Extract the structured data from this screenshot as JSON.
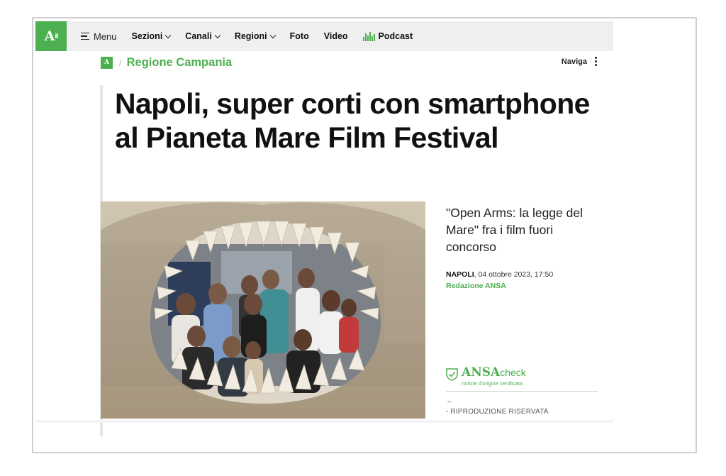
{
  "nav": {
    "logo_text": "A",
    "logo_suffix": "it",
    "menu_label": "Menu",
    "items": [
      {
        "label": "Sezioni",
        "dropdown": true
      },
      {
        "label": "Canali",
        "dropdown": true
      },
      {
        "label": "Regioni",
        "dropdown": true
      },
      {
        "label": "Foto",
        "dropdown": false
      },
      {
        "label": "Video",
        "dropdown": false
      }
    ],
    "podcast_label": "Podcast"
  },
  "breadcrumb": {
    "logo_text": "A",
    "separator": "/",
    "section": "Regione Campania",
    "naviga_label": "Naviga"
  },
  "article": {
    "headline": "Napoli, super corti con smartphone al Pianeta Mare Film Festival",
    "subtitle": "\"Open Arms: la legge del Mare\" fra i film fuori concorso",
    "location": "NAPOLI",
    "datetime": ", 04 ottobre 2023, 17:50",
    "author": "Redazione ANSA",
    "rights": "- RIPRODUZIONE RISERVATA",
    "back_arrow": "←"
  },
  "ansacheck": {
    "brand": "ANSA",
    "suffix": "check",
    "tagline": "notizie d'origine certificata"
  },
  "colors": {
    "brand_green": "#4caf50",
    "nav_background": "#efefef",
    "text_dark": "#111111"
  }
}
